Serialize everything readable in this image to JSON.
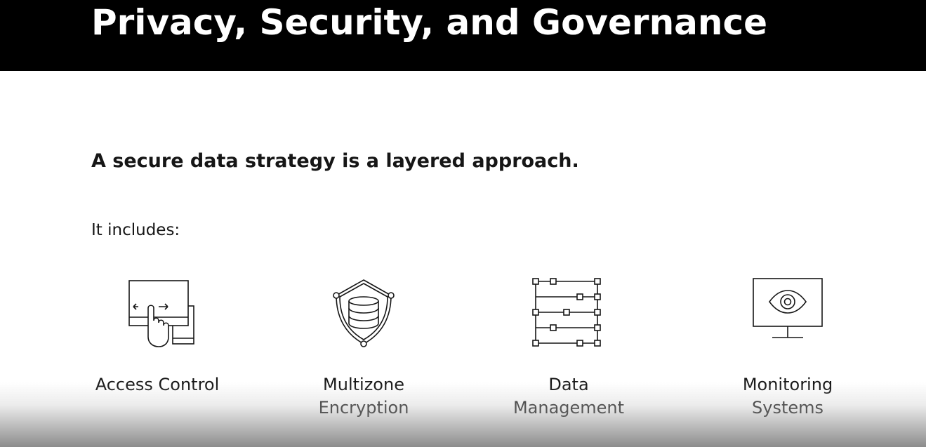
{
  "header": {
    "title": "Privacy, Security, and Governance"
  },
  "content": {
    "subtitle": "A secure data strategy is a layered approach.",
    "intro": "It includes:",
    "items": [
      {
        "label_line1": "Access Control",
        "label_line2": "",
        "icon": "access-control-icon"
      },
      {
        "label_line1": "Multizone",
        "label_line2": "Encryption",
        "icon": "encryption-shield-icon"
      },
      {
        "label_line1": "Data",
        "label_line2": "Management",
        "icon": "data-management-icon"
      },
      {
        "label_line1": "Monitoring",
        "label_line2": "Systems",
        "icon": "monitoring-eye-icon"
      }
    ]
  },
  "colors": {
    "header_bg": "#000000",
    "header_text": "#ffffff",
    "body_text": "#161616",
    "icon_stroke": "#161616"
  }
}
